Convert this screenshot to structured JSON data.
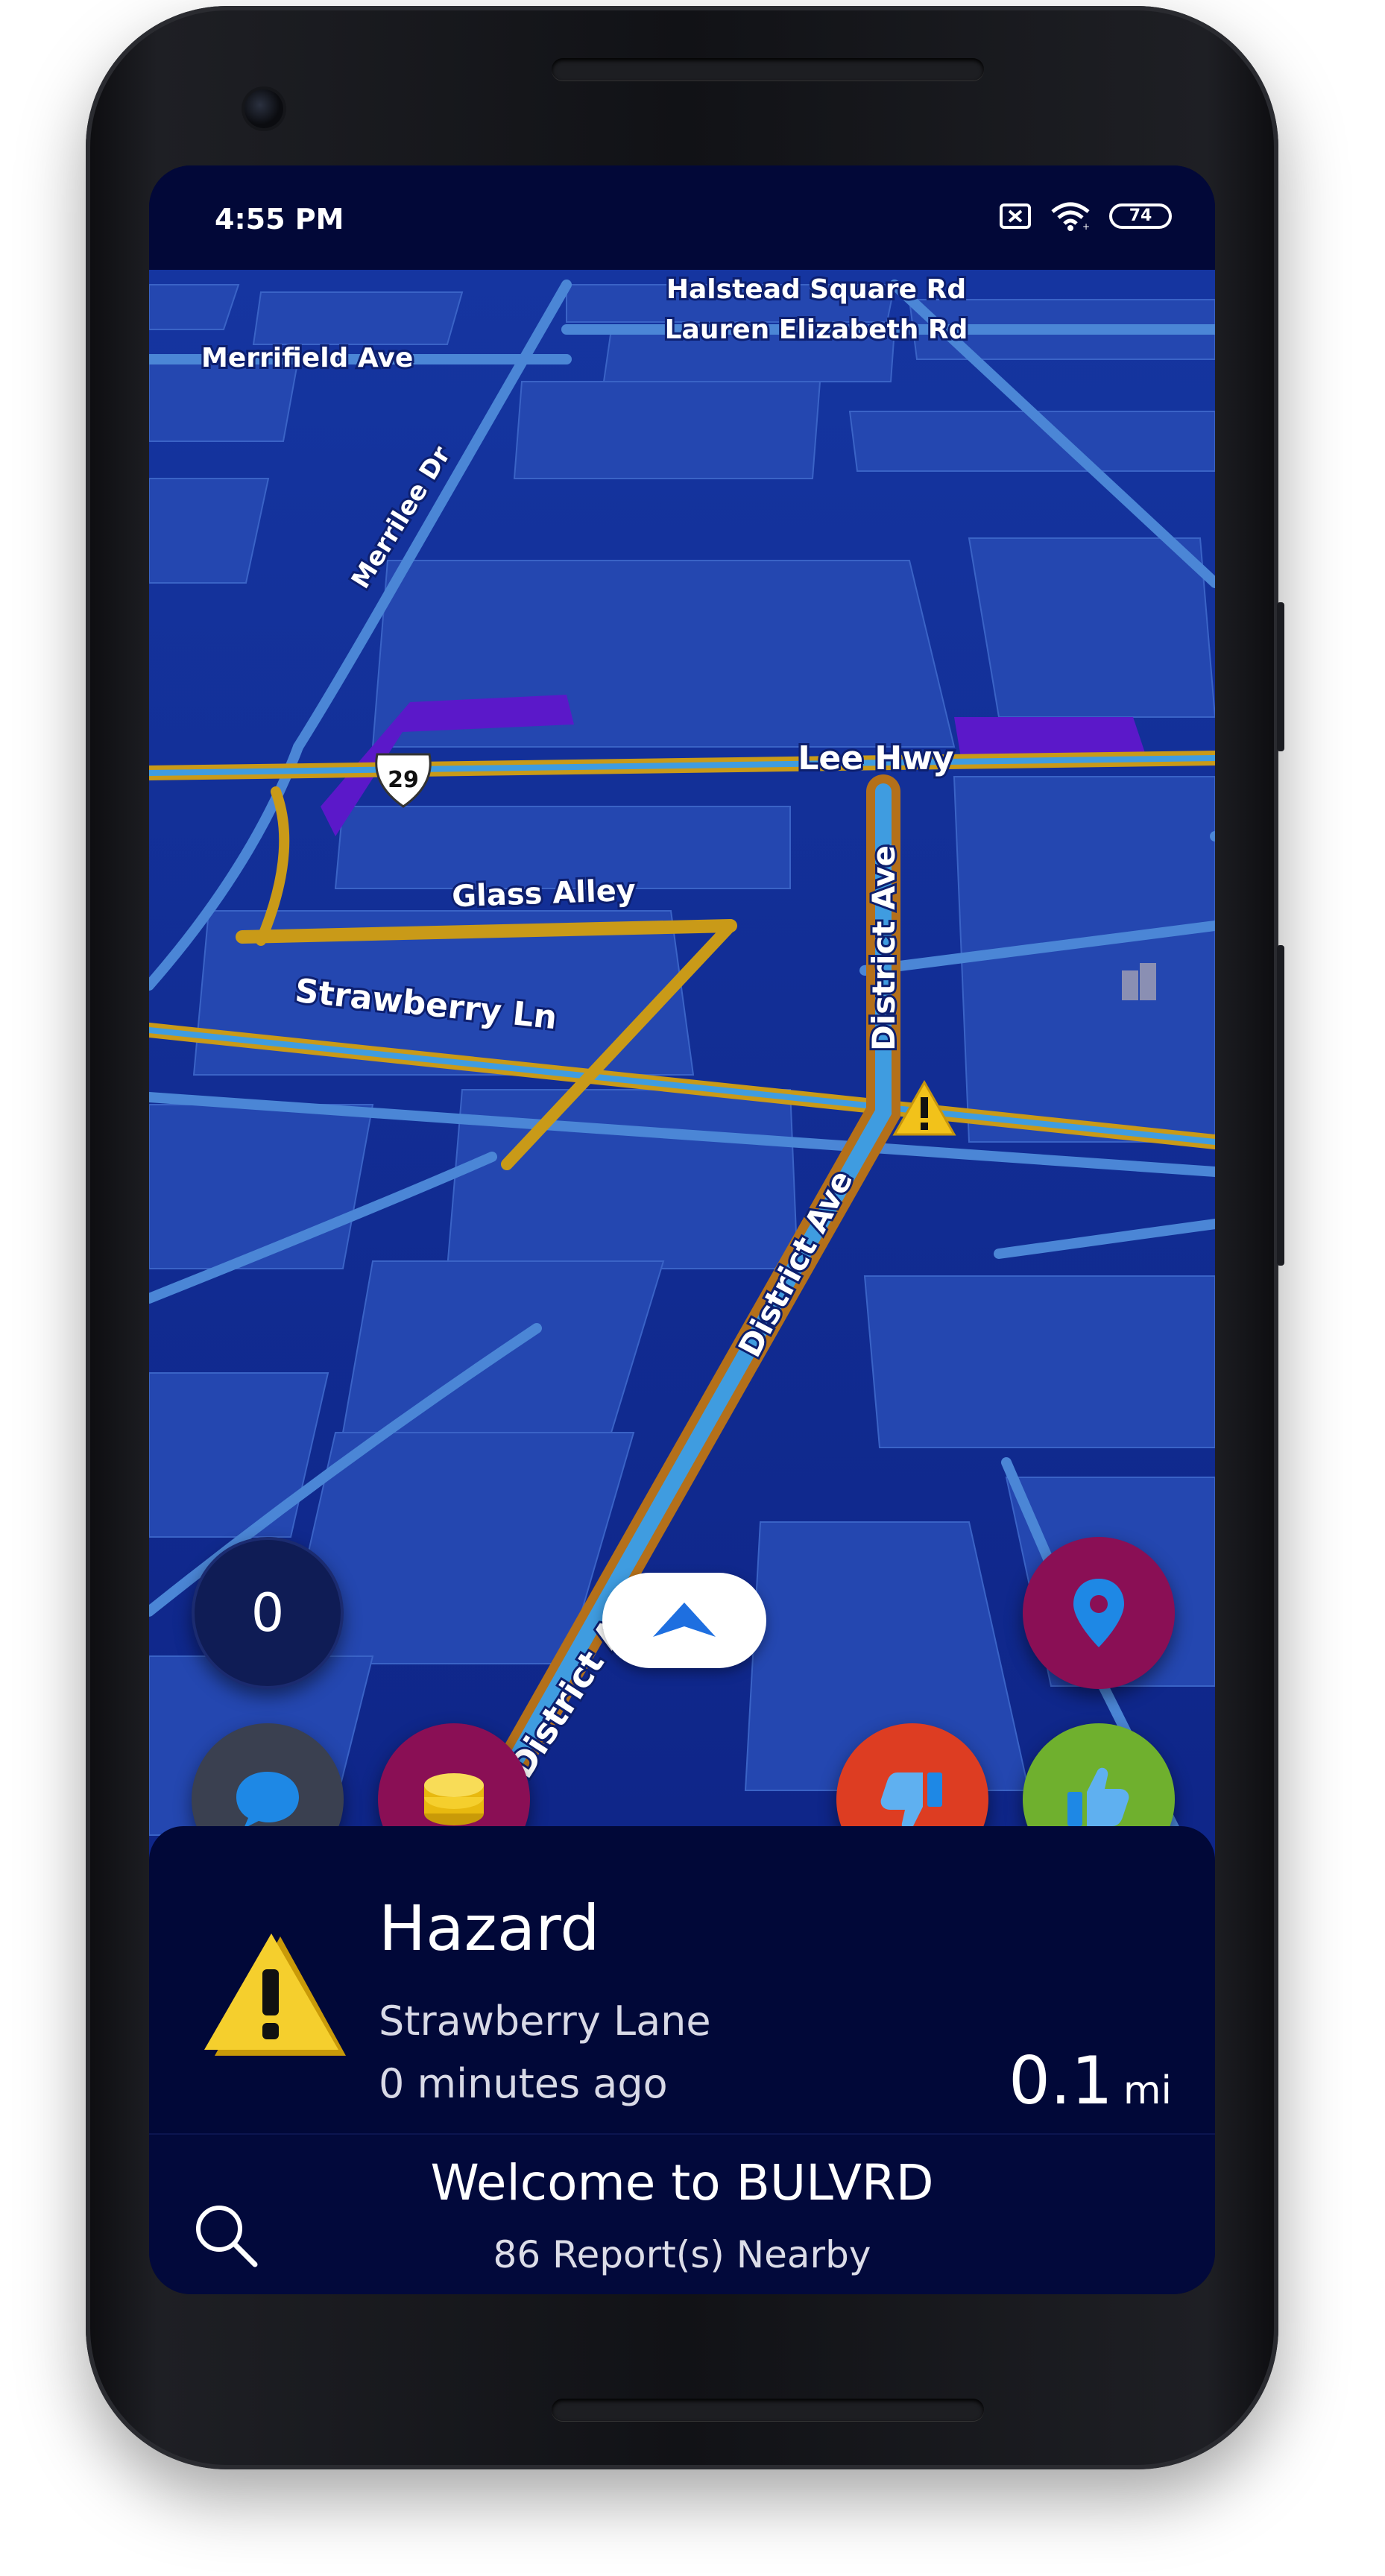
{
  "status_bar": {
    "time": "4:55 PM",
    "battery": "74"
  },
  "map": {
    "street_labels": {
      "halstead": "Halstead Square Rd",
      "lauren": "Lauren Elizabeth Rd",
      "merrifield": "Merrifield Ave",
      "merrilee": "Merrilee Dr",
      "route_shield": "29",
      "lee_hwy": "Lee Hwy",
      "glass_alley": "Glass Alley",
      "strawberry": "Strawberry Ln",
      "district_upper": "District Ave",
      "district_mid": "District Ave",
      "district_lower": "District Ave"
    },
    "colors": {
      "background": "#0a1a7a",
      "building": "#1f3fa6",
      "road": "#4b86d6",
      "route": "#e0b21b",
      "highlight": "#5b18c9"
    }
  },
  "controls": {
    "report_count": "0",
    "colors": {
      "location": "#8a0f55",
      "coins": "#8a0f55",
      "chat": "#3a4050",
      "thumbs_down": "#dd3d22",
      "thumbs_up": "#6fb02e"
    }
  },
  "alert_card": {
    "type": "Hazard",
    "street": "Strawberry Lane",
    "time_ago": "0 minutes ago",
    "distance_value": "0.1",
    "distance_unit": "mi"
  },
  "bottom_bar": {
    "welcome": "Welcome to BULVRD",
    "reports": "86 Report(s) Nearby"
  }
}
